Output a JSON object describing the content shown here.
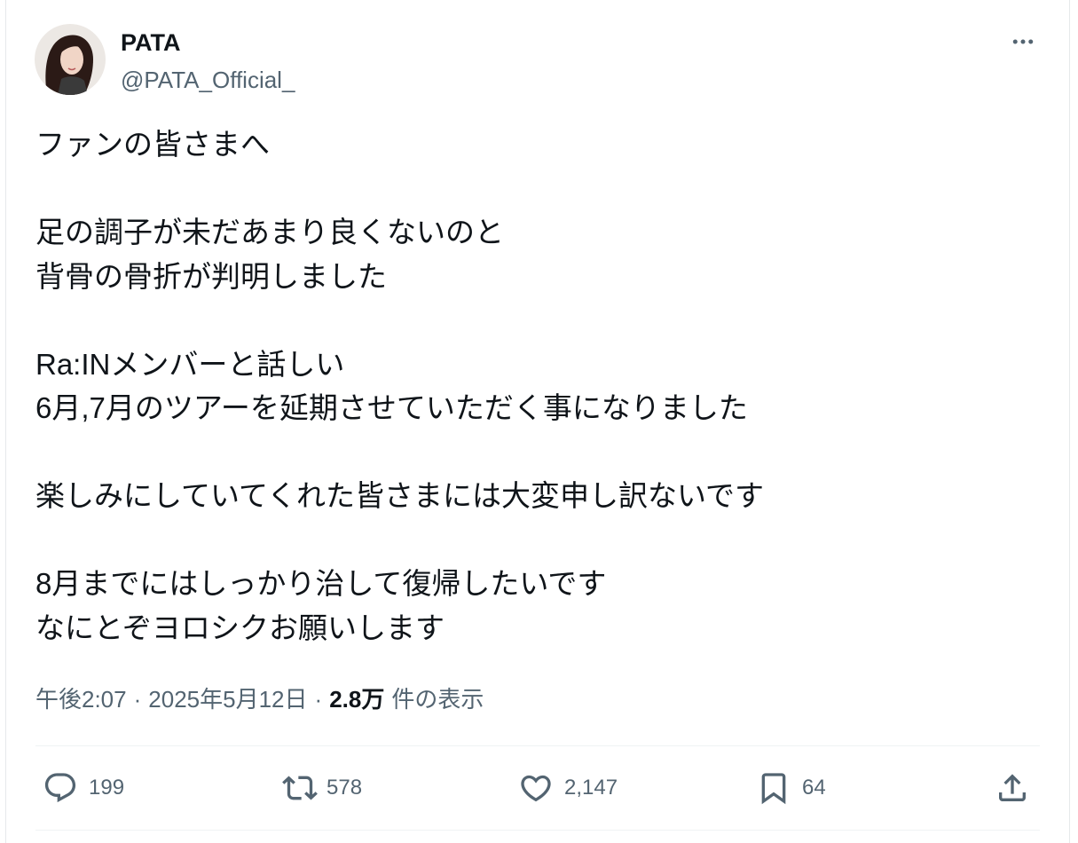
{
  "user": {
    "name": "PATA",
    "handle": "@PATA_Official_"
  },
  "tweet": {
    "paragraphs": [
      [
        "ファンの皆さまへ"
      ],
      [
        "足の調子が未だあまり良くないのと",
        "背骨の骨折が判明しました"
      ],
      [
        "Ra:INメンバーと話しい",
        "6月,7月のツアーを延期させていただく事になりました"
      ],
      [
        "楽しみにしていてくれた皆さまには大変申し訳ないです"
      ],
      [
        "8月までにはしっかり治して復帰したいです",
        "なにとぞヨロシクお願いします"
      ]
    ]
  },
  "meta": {
    "time": "午後2:07",
    "sep": "·",
    "date": "2025年5月12日",
    "views": "2.8万",
    "views_label": "件の表示"
  },
  "actions": {
    "replies": "199",
    "retweets": "578",
    "likes": "2,147",
    "bookmarks": "64"
  },
  "icons": {
    "more": "more-icon",
    "reply": "reply-icon",
    "retweet": "retweet-icon",
    "like": "heart-icon",
    "bookmark": "bookmark-icon",
    "share": "share-icon"
  },
  "colors": {
    "text": "#0f1419",
    "secondary": "#536471",
    "divider": "#eff3f4"
  }
}
